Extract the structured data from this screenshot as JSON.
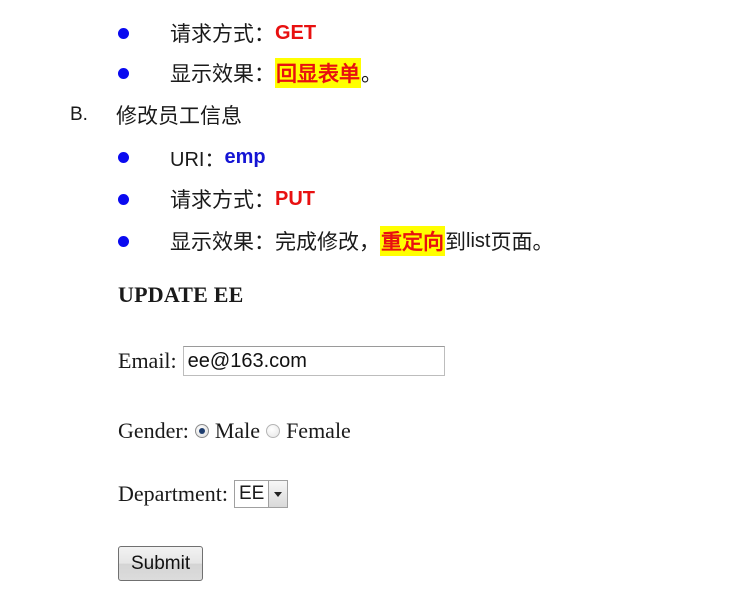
{
  "top_list": [
    {
      "label": "请求方式：",
      "value": "GET"
    },
    {
      "label": "显示效果：",
      "value": "回显表单",
      "suffix": "。"
    }
  ],
  "section_b": {
    "letter": "B.",
    "heading": "修改员工信息",
    "items": {
      "uri": {
        "label": "URI：",
        "value": "emp"
      },
      "method": {
        "label": "请求方式：",
        "value": "PUT"
      },
      "effect": {
        "label": "显示效果：完成修改，",
        "highlight": "重定向",
        "suffix_1": "到 ",
        "suffix_2": "list",
        "suffix_3": " 页面。"
      }
    }
  },
  "form": {
    "title": "UPDATE EE",
    "email_label": "Email:",
    "email_value": "ee@163.com",
    "gender_label": "Gender:",
    "gender_options": [
      "Male",
      "Female"
    ],
    "gender_selected": "Male",
    "department_label": "Department:",
    "department_selected": "EE",
    "submit_label": "Submit"
  },
  "colors": {
    "bullet": "#0a0af0",
    "red_value": "#e81010",
    "blue_value": "#1414d4",
    "highlight": "#ffff00"
  }
}
